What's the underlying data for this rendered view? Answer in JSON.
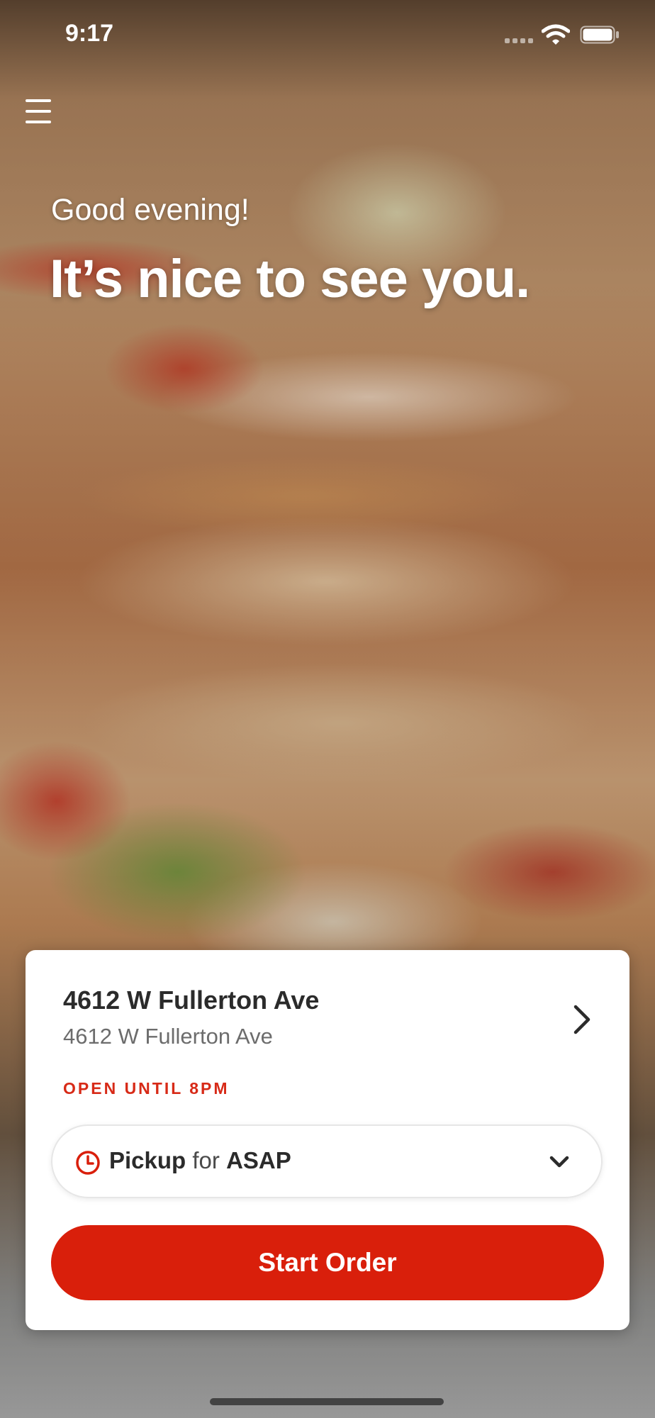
{
  "status_bar": {
    "time": "9:17",
    "signal_icon": "cellular-signal-icon",
    "wifi_icon": "wifi-icon",
    "battery_icon": "battery-icon"
  },
  "header": {
    "menu_icon": "hamburger-menu-icon"
  },
  "hero": {
    "greeting": "Good evening!",
    "headline": "It’s nice to see you.",
    "background": "sandwich photo"
  },
  "store": {
    "name": "4612 W Fullerton Ave",
    "address": "4612 W Fullerton Ave",
    "hours": "OPEN UNTIL 8PM",
    "chevron_icon": "chevron-right-icon"
  },
  "order_mode": {
    "mode": "Pickup",
    "connector": "for",
    "time": "ASAP",
    "clock_icon": "clock-icon",
    "dropdown_icon": "chevron-down-icon"
  },
  "actions": {
    "start_order_label": "Start Order"
  },
  "colors": {
    "accent": "#d91f0b",
    "hours_text": "#d72a17",
    "card_background": "#ffffff",
    "primary_text": "#2b2b2b",
    "secondary_text": "#6c6c6c"
  }
}
